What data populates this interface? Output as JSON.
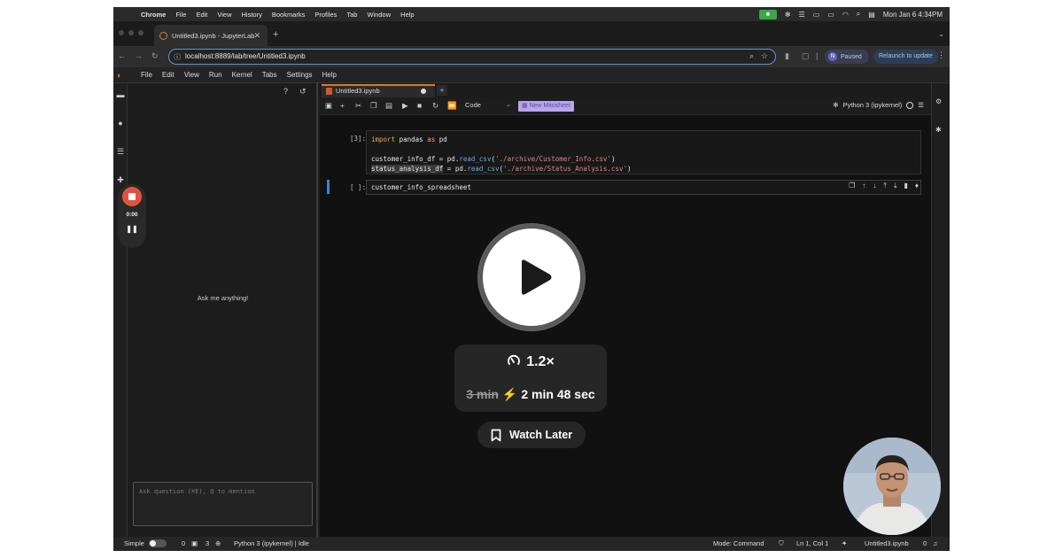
{
  "menubar": {
    "app": "Chrome",
    "items": [
      "File",
      "Edit",
      "View",
      "History",
      "Bookmarks",
      "Profiles",
      "Tab",
      "Window",
      "Help"
    ],
    "clock": "Mon Jan 6  4:34PM"
  },
  "browser": {
    "tab_title": "Untitled3.ipynb - JupyterLab",
    "url": "localhost:8889/lab/tree/Untitled3.ipynb",
    "profile_initial": "N",
    "profile_status": "Paused",
    "relaunch_label": "Relaunch to update"
  },
  "jupyter_menu": [
    "File",
    "Edit",
    "View",
    "Run",
    "Kernel",
    "Tabs",
    "Settings",
    "Help"
  ],
  "chat": {
    "prompt": "Ask me anything!",
    "input_placeholder": "Ask question (⌘E), @ to mention"
  },
  "recorder": {
    "time": "0:00"
  },
  "notebook": {
    "tab_title": "Untitled3.ipynb",
    "cell_type": "Code",
    "mitosheet_label": "New Mitosheet",
    "kernel": "Python 3 (ipykernel)",
    "cells": [
      {
        "prompt": "[3]:",
        "lines": [
          "import pandas as pd",
          "",
          "customer_info_df = pd.read_csv('./archive/Customer_Info.csv')",
          "status_analysis_df = pd.read_csv('./archive/Status_Analysis.csv')"
        ]
      },
      {
        "prompt": "[ ]:",
        "lines": [
          "customer_info_spreadsheet"
        ]
      }
    ]
  },
  "statusbar": {
    "mode_label": "Simple",
    "terminals": "0",
    "kernels": "3",
    "kernel_status": "Python 3 (ipykernel) | Idle",
    "mode": "Mode: Command",
    "cursor": "Ln 1, Col 1",
    "file": "Untitled3.ipynb",
    "notifications": "0"
  },
  "video": {
    "speed": "1.2×",
    "original_duration": "3 min",
    "new_duration": "2 min 48 sec",
    "watch_later": "Watch Later"
  }
}
